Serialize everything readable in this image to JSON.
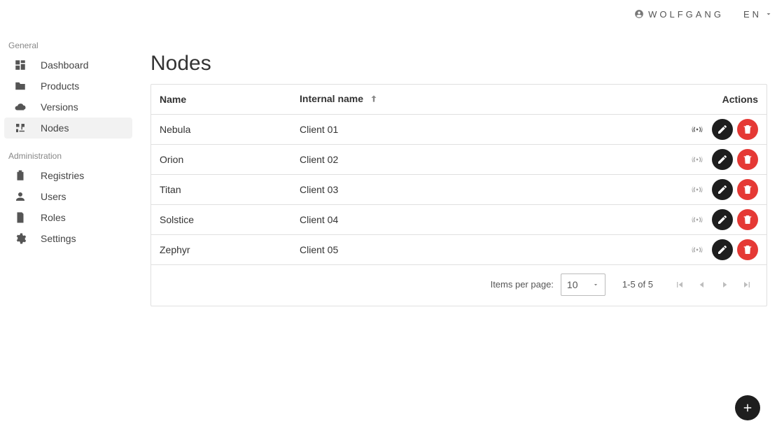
{
  "header": {
    "username": "WOLFGANG",
    "language": "EN"
  },
  "sidebar": {
    "sections": [
      {
        "label": "General",
        "items": [
          {
            "key": "dashboard",
            "label": "Dashboard",
            "icon": "dashboard-icon",
            "active": false
          },
          {
            "key": "products",
            "label": "Products",
            "icon": "folder-icon",
            "active": false
          },
          {
            "key": "versions",
            "label": "Versions",
            "icon": "cloud-icon",
            "active": false
          },
          {
            "key": "nodes",
            "label": "Nodes",
            "icon": "nodes-icon",
            "active": true
          }
        ]
      },
      {
        "label": "Administration",
        "items": [
          {
            "key": "registries",
            "label": "Registries",
            "icon": "clipboard-icon"
          },
          {
            "key": "users",
            "label": "Users",
            "icon": "user-icon"
          },
          {
            "key": "roles",
            "label": "Roles",
            "icon": "role-icon"
          },
          {
            "key": "settings",
            "label": "Settings",
            "icon": "gear-icon"
          }
        ]
      }
    ]
  },
  "page": {
    "title": "Nodes",
    "columns": {
      "name": "Name",
      "internal": "Internal name",
      "actions": "Actions"
    },
    "sort": {
      "column": "internal",
      "dir": "asc"
    },
    "rows": [
      {
        "name": "Nebula",
        "internal": "Client 01",
        "online": true
      },
      {
        "name": "Orion",
        "internal": "Client 02",
        "online": false
      },
      {
        "name": "Titan",
        "internal": "Client 03",
        "online": false
      },
      {
        "name": "Solstice",
        "internal": "Client 04",
        "online": false
      },
      {
        "name": "Zephyr",
        "internal": "Client 05",
        "online": false
      }
    ],
    "footer": {
      "items_per_page_label": "Items per page:",
      "per_page": "10",
      "range": "1-5 of 5"
    }
  },
  "icons": {
    "dashboard-icon": "dashboard",
    "folder-icon": "folder",
    "cloud-icon": "cloud",
    "nodes-icon": "nodes",
    "clipboard-icon": "clipboard",
    "user-icon": "user",
    "role-icon": "role",
    "gear-icon": "gear"
  }
}
